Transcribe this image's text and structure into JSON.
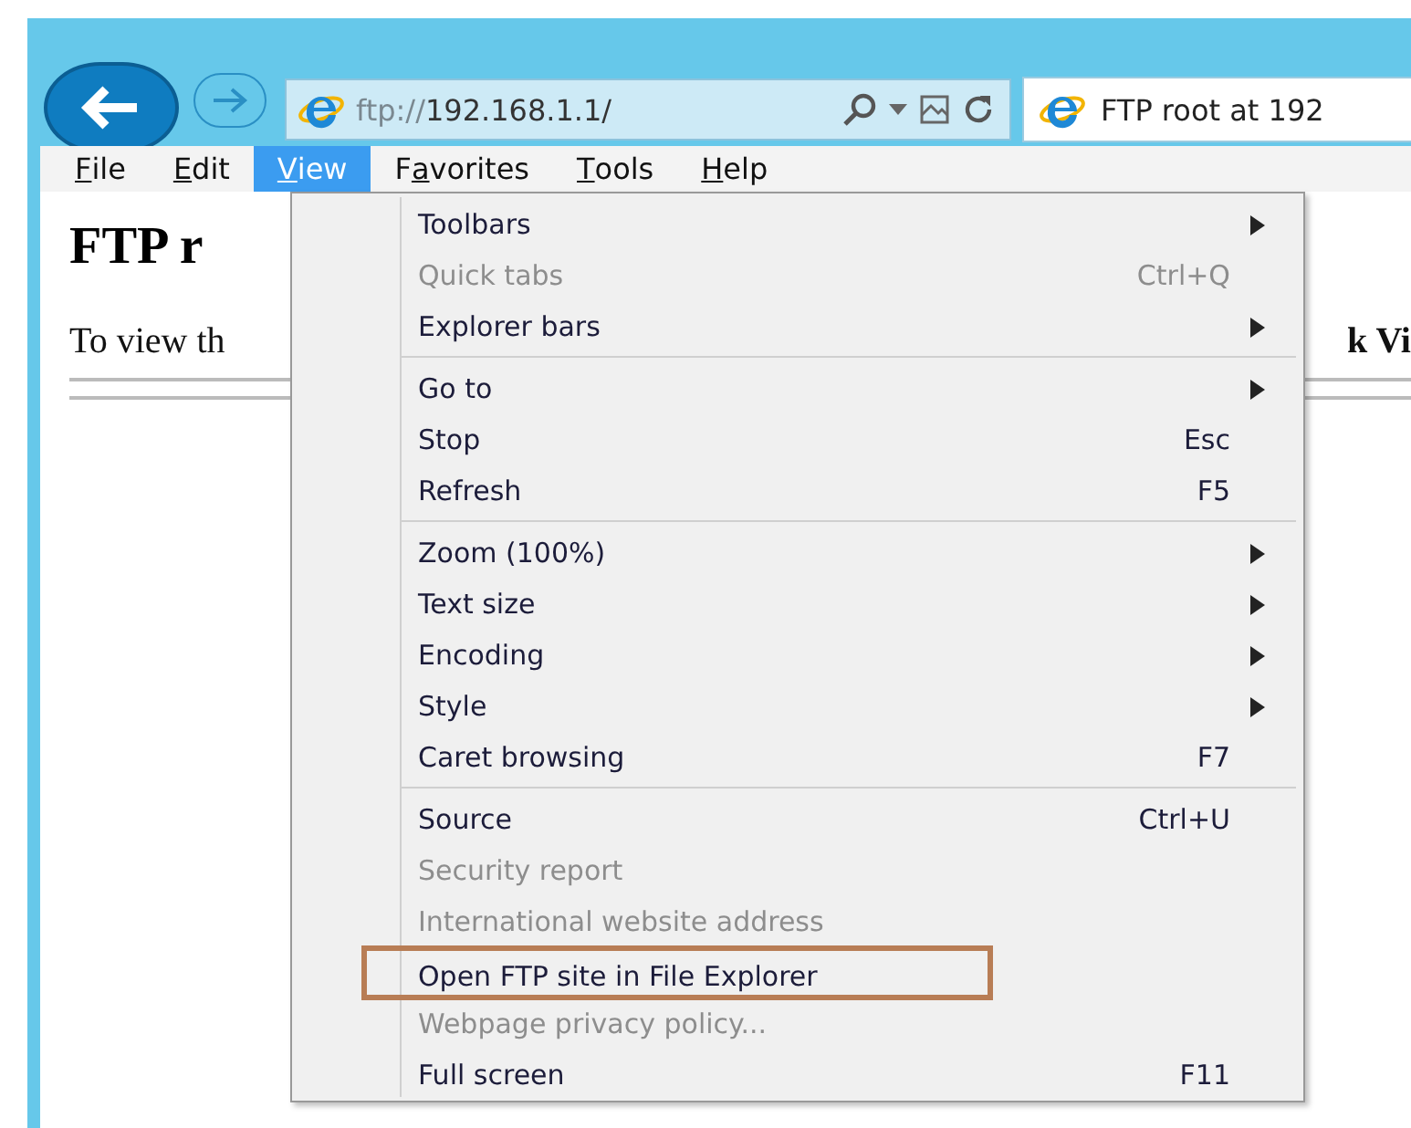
{
  "address_bar": {
    "url_prefix": "ftp://",
    "url_host": "192.168.1.1/"
  },
  "tab": {
    "title": "FTP root at 192"
  },
  "menu_bar": [
    {
      "mnemonic": "F",
      "rest": "ile",
      "selected": false
    },
    {
      "mnemonic": "E",
      "rest": "dit",
      "selected": false
    },
    {
      "mnemonic": "V",
      "rest": "iew",
      "selected": true
    },
    {
      "lead": "F",
      "mnemonic": "a",
      "rest": "vorites",
      "selected": false
    },
    {
      "mnemonic": "T",
      "rest": "ools",
      "selected": false
    },
    {
      "mnemonic": "H",
      "rest": "elp",
      "selected": false
    }
  ],
  "page": {
    "heading": "FTP r",
    "text_left": "To view th",
    "text_right": "k Vi"
  },
  "view_menu": [
    {
      "kind": "item",
      "label": "Toolbars",
      "submenu": true,
      "disabled": false
    },
    {
      "kind": "item",
      "label": "Quick tabs",
      "shortcut": "Ctrl+Q",
      "disabled": true
    },
    {
      "kind": "item",
      "label": "Explorer bars",
      "submenu": true,
      "disabled": false
    },
    {
      "kind": "separator"
    },
    {
      "kind": "item",
      "label": "Go to",
      "submenu": true,
      "disabled": false
    },
    {
      "kind": "item",
      "label": "Stop",
      "shortcut": "Esc",
      "disabled": false
    },
    {
      "kind": "item",
      "label": "Refresh",
      "shortcut": "F5",
      "disabled": false
    },
    {
      "kind": "separator"
    },
    {
      "kind": "item",
      "label": "Zoom (100%)",
      "submenu": true,
      "disabled": false
    },
    {
      "kind": "item",
      "label": "Text size",
      "submenu": true,
      "disabled": false
    },
    {
      "kind": "item",
      "label": "Encoding",
      "submenu": true,
      "disabled": false
    },
    {
      "kind": "item",
      "label": "Style",
      "submenu": true,
      "disabled": false
    },
    {
      "kind": "item",
      "label": "Caret browsing",
      "shortcut": "F7",
      "disabled": false
    },
    {
      "kind": "separator"
    },
    {
      "kind": "item",
      "label": "Source",
      "shortcut": "Ctrl+U",
      "disabled": false
    },
    {
      "kind": "item",
      "label": "Security report",
      "disabled": true
    },
    {
      "kind": "item",
      "label": "International website address",
      "disabled": true
    },
    {
      "kind": "item",
      "label": "Open FTP site in File Explorer",
      "disabled": false,
      "annotated": true
    },
    {
      "kind": "item",
      "label": "Webpage privacy policy...",
      "disabled": true
    },
    {
      "kind": "item",
      "label": "Full screen",
      "shortcut": "F11",
      "disabled": false
    }
  ]
}
